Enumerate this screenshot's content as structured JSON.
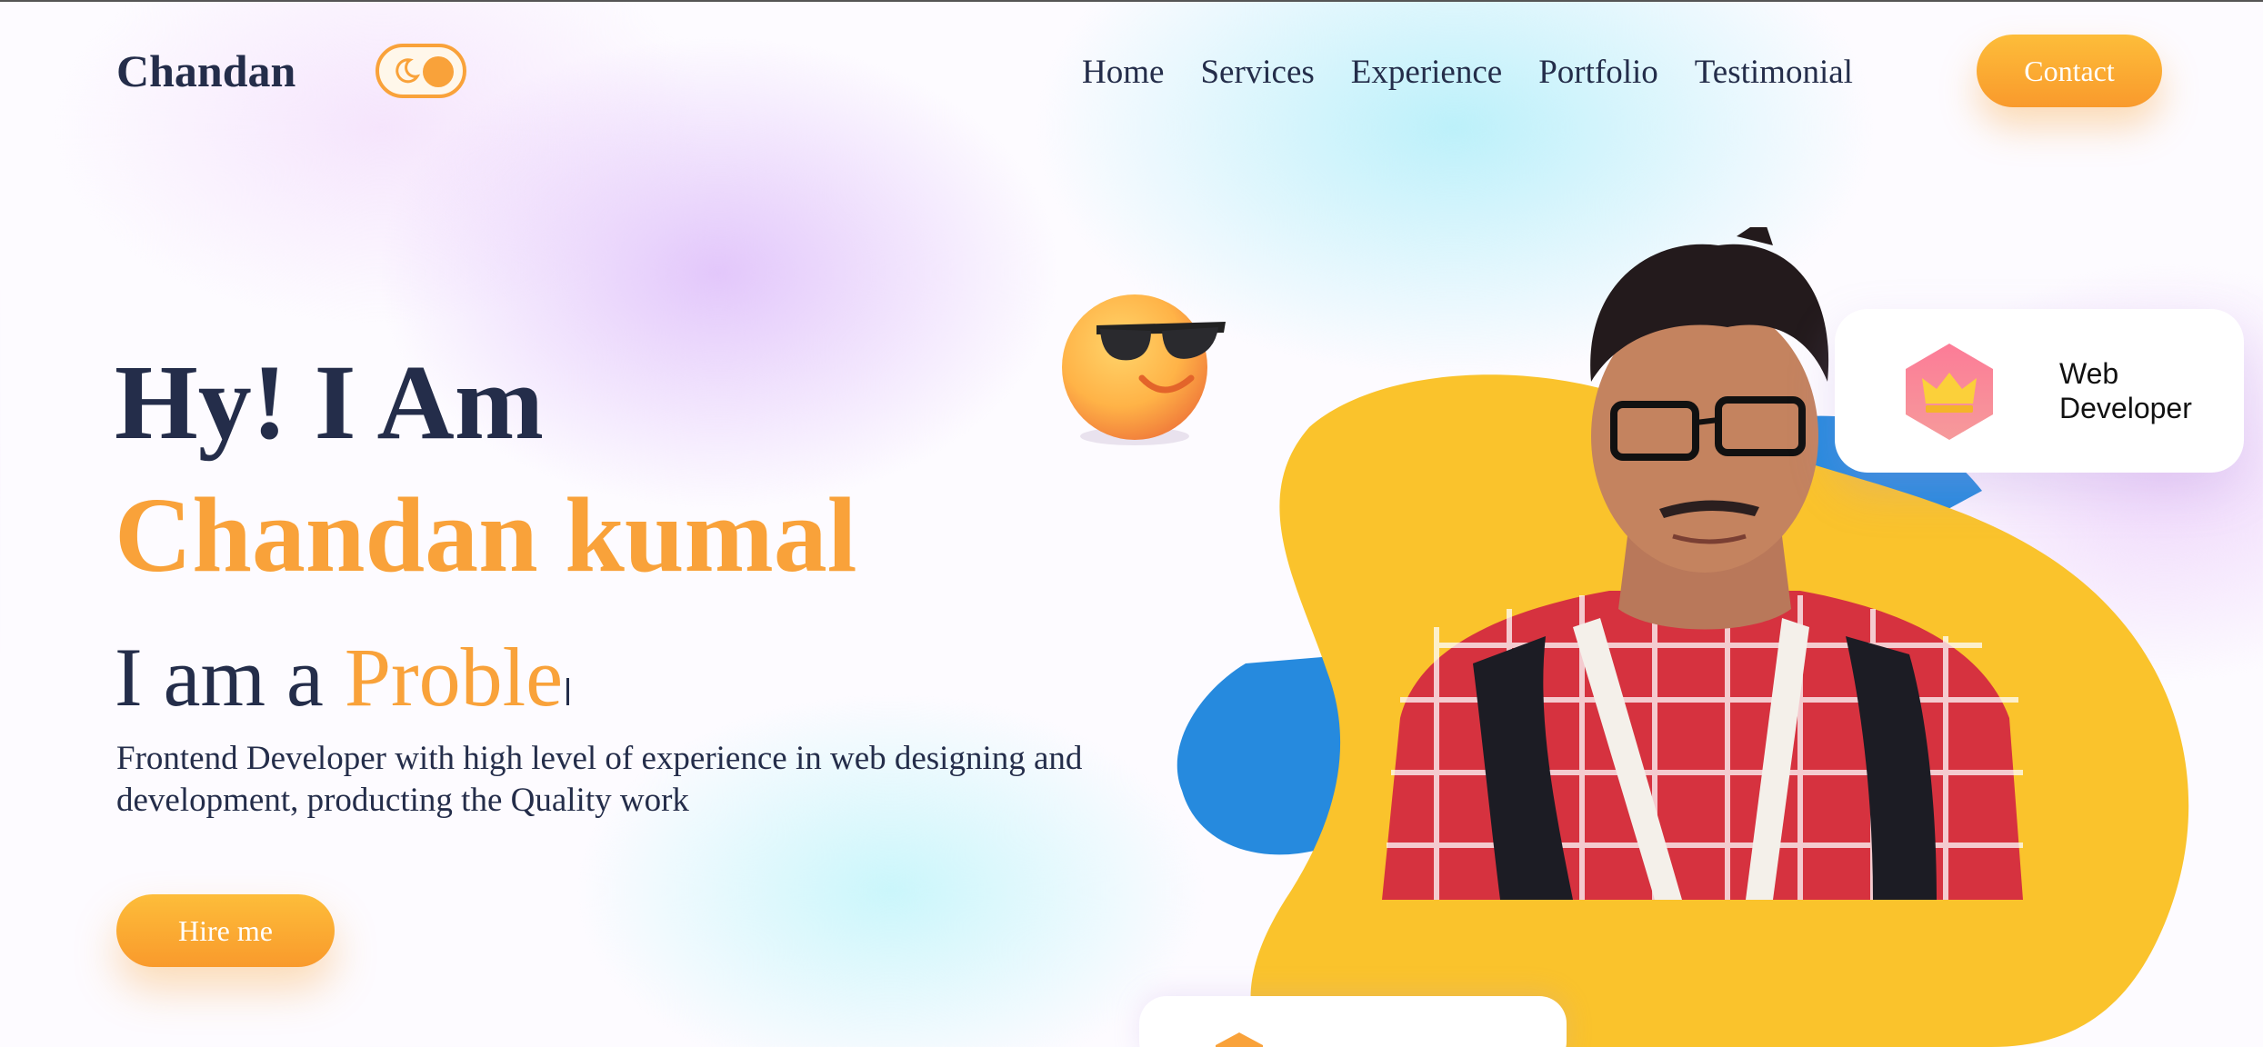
{
  "header": {
    "logo": "Chandan",
    "theme_toggle": {
      "icon": "moon-icon",
      "state": "light"
    },
    "nav": [
      "Home",
      "Services",
      "Experience",
      "Portfolio",
      "Testimonial"
    ],
    "contact_label": "Contact"
  },
  "hero": {
    "greeting": "Hy! I Am",
    "name": "Chandan kumal",
    "role_prefix": "I am a",
    "role_typed": "Proble",
    "description": "Frontend Developer with high level of experience in web designing and development, producting the Quality work",
    "hire_label": "Hire me",
    "emoji": "sunglasses-emoji-icon"
  },
  "cards": {
    "web": {
      "icon": "crown-icon",
      "line1": "Web",
      "line2": "Developer"
    },
    "bottom": {
      "icon": "badge-icon"
    }
  },
  "colors": {
    "accent": "#f9a23a",
    "text": "#242d4a",
    "blob_yellow": "#fac32c",
    "blob_blue": "#268ade"
  }
}
